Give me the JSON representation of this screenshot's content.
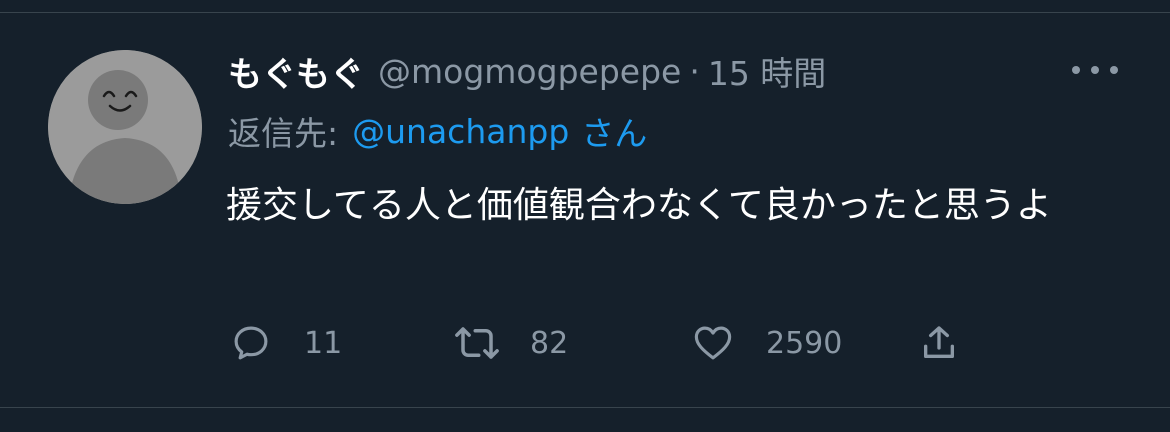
{
  "tweet": {
    "display_name": "もぐもぐ",
    "handle": "@mogmogpepepe",
    "separator": "·",
    "time": "15 時間",
    "reply_prefix": "返信先:",
    "reply_to_handle": "@unachanpp",
    "reply_to_suffix": "さん",
    "text": "援交してる人と価値観合わなくて良かったと思うよ",
    "more_icon": "more-horizontal-icon"
  },
  "actions": {
    "reply_count": "11",
    "retweet_count": "82",
    "like_count": "2590",
    "icons": [
      "reply-icon",
      "retweet-icon",
      "like-icon",
      "share-icon"
    ]
  },
  "colors": {
    "background": "#15202b",
    "primary_text": "#ffffff",
    "secondary_text": "#8b98a5",
    "link": "#1d9bf0",
    "avatar": "#9b9b9b"
  }
}
